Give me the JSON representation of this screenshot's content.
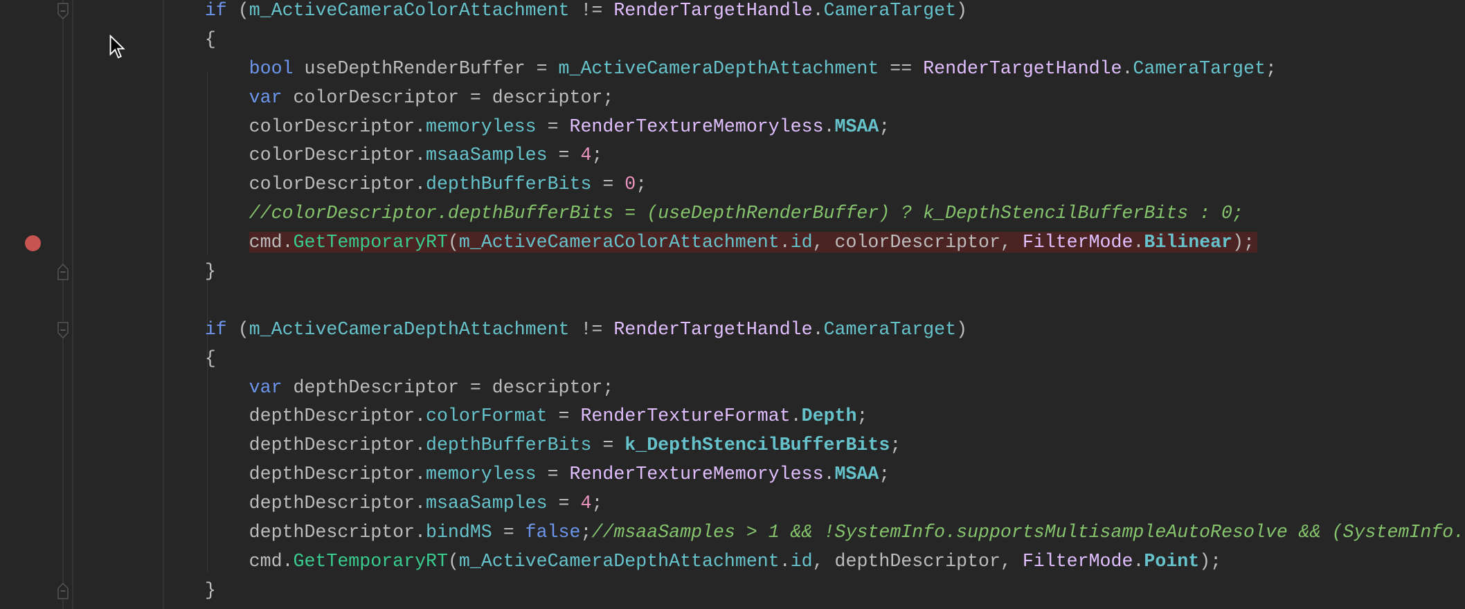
{
  "editor": {
    "colors": {
      "background": "#262626",
      "keyword": "#6c95eb",
      "text": "#bdbdbd",
      "member": "#66c3cc",
      "type": "#e1bfff",
      "method": "#39cc8f",
      "number": "#ed94c0",
      "comment": "#85c46c",
      "breakpoint": "#c75450",
      "breakpoint_line": "#4a2322"
    },
    "lines": [
      {
        "indent": 1,
        "fold": "start",
        "tokens": [
          [
            "kw",
            "if"
          ],
          [
            "pl",
            " ("
          ],
          [
            "mem",
            "m_ActiveCameraColorAttachment"
          ],
          [
            "pl",
            " != "
          ],
          [
            "ty",
            "RenderTargetHandle"
          ],
          [
            "pl",
            "."
          ],
          [
            "mem",
            "CameraTarget"
          ],
          [
            "pl",
            ")"
          ]
        ]
      },
      {
        "indent": 1,
        "tokens": [
          [
            "pl",
            "{"
          ]
        ]
      },
      {
        "indent": 2,
        "tokens": [
          [
            "kw",
            "bool"
          ],
          [
            "pl",
            " useDepthRenderBuffer = "
          ],
          [
            "mem",
            "m_ActiveCameraDepthAttachment"
          ],
          [
            "pl",
            " == "
          ],
          [
            "ty",
            "RenderTargetHandle"
          ],
          [
            "pl",
            "."
          ],
          [
            "mem",
            "CameraTarget"
          ],
          [
            "pl",
            ";"
          ]
        ]
      },
      {
        "indent": 2,
        "tokens": [
          [
            "kw",
            "var"
          ],
          [
            "pl",
            " colorDescriptor = descriptor;"
          ]
        ]
      },
      {
        "indent": 2,
        "tokens": [
          [
            "pl",
            "colorDescriptor."
          ],
          [
            "mem",
            "memoryless"
          ],
          [
            "pl",
            " = "
          ],
          [
            "ty",
            "RenderTextureMemoryless"
          ],
          [
            "pl",
            "."
          ],
          [
            "en",
            "MSAA"
          ],
          [
            "pl",
            ";"
          ]
        ]
      },
      {
        "indent": 2,
        "tokens": [
          [
            "pl",
            "colorDescriptor."
          ],
          [
            "mem",
            "msaaSamples"
          ],
          [
            "pl",
            " = "
          ],
          [
            "num",
            "4"
          ],
          [
            "pl",
            ";"
          ]
        ]
      },
      {
        "indent": 2,
        "tokens": [
          [
            "pl",
            "colorDescriptor."
          ],
          [
            "mem",
            "depthBufferBits"
          ],
          [
            "pl",
            " = "
          ],
          [
            "num",
            "0"
          ],
          [
            "pl",
            ";"
          ]
        ]
      },
      {
        "indent": 2,
        "tokens": [
          [
            "cm",
            "//colorDescriptor.depthBufferBits = (useDepthRenderBuffer) ? k_DepthStencilBufferBits : 0;"
          ]
        ]
      },
      {
        "indent": 2,
        "breakpoint": true,
        "tokens": [
          [
            "pl",
            "cmd."
          ],
          [
            "fn",
            "GetTemporaryRT"
          ],
          [
            "pl",
            "("
          ],
          [
            "mem",
            "m_ActiveCameraColorAttachment"
          ],
          [
            "pl",
            "."
          ],
          [
            "mem",
            "id"
          ],
          [
            "pl",
            ", colorDescriptor, "
          ],
          [
            "ty",
            "FilterMode"
          ],
          [
            "pl",
            "."
          ],
          [
            "en",
            "Bilinear"
          ],
          [
            "pl",
            ");"
          ]
        ]
      },
      {
        "indent": 1,
        "fold": "end",
        "tokens": [
          [
            "pl",
            "}"
          ]
        ]
      },
      {
        "indent": 0,
        "tokens": []
      },
      {
        "indent": 1,
        "fold": "start",
        "tokens": [
          [
            "kw",
            "if"
          ],
          [
            "pl",
            " ("
          ],
          [
            "mem",
            "m_ActiveCameraDepthAttachment"
          ],
          [
            "pl",
            " != "
          ],
          [
            "ty",
            "RenderTargetHandle"
          ],
          [
            "pl",
            "."
          ],
          [
            "mem",
            "CameraTarget"
          ],
          [
            "pl",
            ")"
          ]
        ]
      },
      {
        "indent": 1,
        "tokens": [
          [
            "pl",
            "{"
          ]
        ]
      },
      {
        "indent": 2,
        "tokens": [
          [
            "kw",
            "var"
          ],
          [
            "pl",
            " depthDescriptor = descriptor;"
          ]
        ]
      },
      {
        "indent": 2,
        "tokens": [
          [
            "pl",
            "depthDescriptor."
          ],
          [
            "mem",
            "colorFormat"
          ],
          [
            "pl",
            " = "
          ],
          [
            "ty",
            "RenderTextureFormat"
          ],
          [
            "pl",
            "."
          ],
          [
            "en",
            "Depth"
          ],
          [
            "pl",
            ";"
          ]
        ]
      },
      {
        "indent": 2,
        "tokens": [
          [
            "pl",
            "depthDescriptor."
          ],
          [
            "mem",
            "depthBufferBits"
          ],
          [
            "pl",
            " = "
          ],
          [
            "en",
            "k_DepthStencilBufferBits"
          ],
          [
            "pl",
            ";"
          ]
        ]
      },
      {
        "indent": 2,
        "tokens": [
          [
            "pl",
            "depthDescriptor."
          ],
          [
            "mem",
            "memoryless"
          ],
          [
            "pl",
            " = "
          ],
          [
            "ty",
            "RenderTextureMemoryless"
          ],
          [
            "pl",
            "."
          ],
          [
            "en",
            "MSAA"
          ],
          [
            "pl",
            ";"
          ]
        ]
      },
      {
        "indent": 2,
        "tokens": [
          [
            "pl",
            "depthDescriptor."
          ],
          [
            "mem",
            "msaaSamples"
          ],
          [
            "pl",
            " = "
          ],
          [
            "num",
            "4"
          ],
          [
            "pl",
            ";"
          ]
        ]
      },
      {
        "indent": 2,
        "tokens": [
          [
            "pl",
            "depthDescriptor."
          ],
          [
            "mem",
            "bindMS"
          ],
          [
            "pl",
            " = "
          ],
          [
            "kw",
            "false"
          ],
          [
            "pl",
            ";"
          ],
          [
            "cm",
            "//msaaSamples > 1 && !SystemInfo.supportsMultisampleAutoResolve && (SystemInfo."
          ]
        ]
      },
      {
        "indent": 2,
        "tokens": [
          [
            "pl",
            "cmd."
          ],
          [
            "fn",
            "GetTemporaryRT"
          ],
          [
            "pl",
            "("
          ],
          [
            "mem",
            "m_ActiveCameraDepthAttachment"
          ],
          [
            "pl",
            "."
          ],
          [
            "mem",
            "id"
          ],
          [
            "pl",
            ", depthDescriptor, "
          ],
          [
            "ty",
            "FilterMode"
          ],
          [
            "pl",
            "."
          ],
          [
            "en",
            "Point"
          ],
          [
            "pl",
            ");"
          ]
        ]
      },
      {
        "indent": 1,
        "fold": "end",
        "tokens": [
          [
            "pl",
            "}"
          ]
        ]
      }
    ]
  }
}
